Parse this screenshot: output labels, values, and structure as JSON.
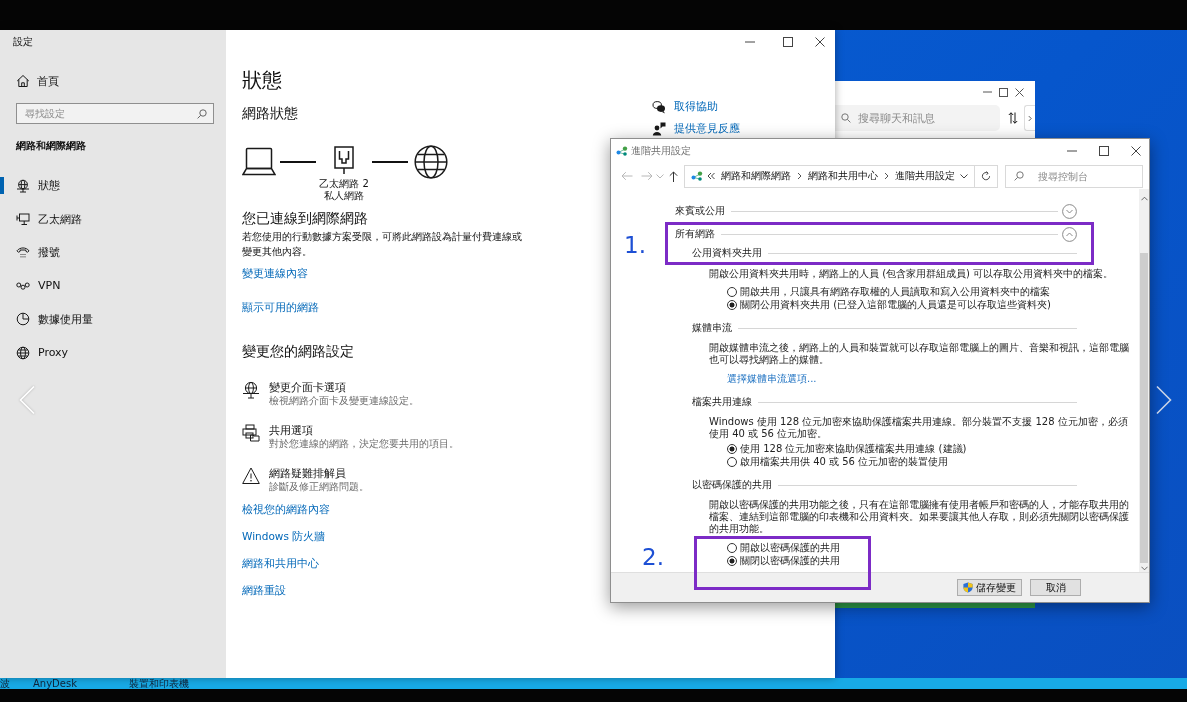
{
  "settings_window": {
    "title": "設定",
    "sidebar": {
      "home": "首頁",
      "search": {
        "placeholder": "尋找設定"
      },
      "section_title": "網路和網際網路",
      "items": [
        {
          "kind": "status",
          "label": "狀態",
          "selected": true
        },
        {
          "kind": "ethernet",
          "label": "乙太網路",
          "selected": false
        },
        {
          "kind": "dialup",
          "label": "撥號",
          "selected": false
        },
        {
          "kind": "vpn",
          "label": "VPN",
          "selected": false
        },
        {
          "kind": "usage",
          "label": "數據使用量",
          "selected": false
        },
        {
          "kind": "proxy",
          "label": "Proxy",
          "selected": false
        }
      ]
    },
    "main": {
      "heading": "狀態",
      "subheading": "網路狀態",
      "diagram": {
        "adapter": "乙太網路 2",
        "profile": "私人網路"
      },
      "connection_title": "您已連線到網際網路",
      "connection_text": "若您使用的行動數據方案受限，可將此網路設為計量付費連線或變更其他內容。",
      "links": [
        "變更連線內容",
        "顯示可用的網路"
      ],
      "settings_heading": "變更您的網路設定",
      "options": [
        {
          "kind": "adapter",
          "title": "變更介面卡選項",
          "description": "檢視網路介面卡及變更連線設定。"
        },
        {
          "kind": "sharing",
          "title": "共用選項",
          "description": "對於您連線的網路，決定您要共用的項目。"
        },
        {
          "kind": "troubleshoot",
          "title": "網路疑難排解員",
          "description": "診斷及修正網路問題。"
        }
      ],
      "more_links": [
        "檢視您的網路內容",
        "Windows 防火牆",
        "網路和共用中心",
        "網路重設"
      ],
      "help_links": [
        {
          "kind": "help",
          "label": "取得協助"
        },
        {
          "kind": "feedback",
          "label": "提供意見反應"
        }
      ]
    }
  },
  "chat_window": {
    "search": {
      "placeholder": "搜尋聊天和訊息"
    }
  },
  "sharing_window": {
    "title": "進階共用設定",
    "breadcrumb": [
      "網路和網際網路",
      "網路和共用中心",
      "進階共用設定"
    ],
    "search": {
      "placeholder": "搜尋控制台"
    },
    "profiles": [
      {
        "label": "來賓或公用",
        "expanded": false
      },
      {
        "label": "所有網路",
        "expanded": true,
        "sections": [
          {
            "title": "公用資料夾共用",
            "description": "開啟公用資料夾共用時，網路上的人員 (包含家用群組成員) 可以存取公用資料夾中的檔案。",
            "options": [
              {
                "label": "開啟共用，只讓具有網路存取權的人員讀取和寫入公用資料夾中的檔案",
                "selected": false
              },
              {
                "label": "關閉公用資料夾共用 (已登入這部電腦的人員還是可以存取這些資料夾)",
                "selected": true
              }
            ]
          },
          {
            "title": "媒體串流",
            "description": "開啟媒體串流之後，網路上的人員和裝置就可以存取這部電腦上的圖片、音樂和視訊，這部電腦也可以尋找網路上的媒體。",
            "link": "選擇媒體串流選項..."
          },
          {
            "title": "檔案共用連線",
            "description": "Windows 使用 128 位元加密來協助保護檔案共用連線。部分裝置不支援 128 位元加密，必須使用 40 或 56 位元加密。",
            "options": [
              {
                "label": "使用 128 位元加密來協助保護檔案共用連線 (建議)",
                "selected": true
              },
              {
                "label": "啟用檔案共用供 40 或 56 位元加密的裝置使用",
                "selected": false
              }
            ]
          },
          {
            "title": "以密碼保護的共用",
            "description": "開啟以密碼保護的共用功能之後，只有在這部電腦擁有使用者帳戶和密碼的人，才能存取共用的檔案、連結到這部電腦的印表機和公用資料夾。如果要讓其他人存取，則必須先關閉以密碼保護的共用功能。",
            "options": [
              {
                "label": "開啟以密碼保護的共用",
                "selected": false
              },
              {
                "label": "關閉以密碼保護的共用",
                "selected": true
              }
            ]
          }
        ]
      }
    ],
    "buttons": [
      {
        "kind": "admin",
        "label": "儲存變更"
      },
      {
        "kind": "plain",
        "label": "取消"
      }
    ]
  },
  "annotations": [
    {
      "label": "1."
    },
    {
      "label": "2."
    }
  ],
  "taskbar": {
    "items": [
      "波",
      "AnyDesk",
      "裝置和印表機"
    ]
  }
}
